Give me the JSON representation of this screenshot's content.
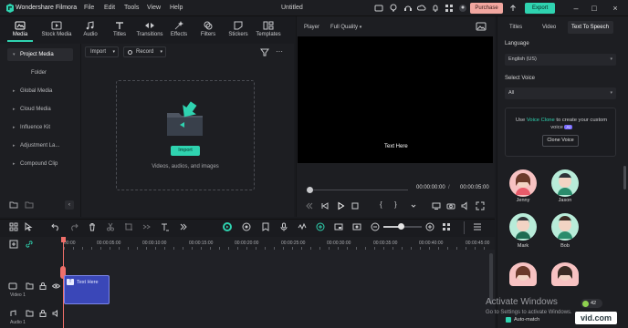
{
  "titlebar": {
    "app_name": "Wondershare Filmora",
    "menu": [
      "File",
      "Edit",
      "Tools",
      "View",
      "Help"
    ],
    "project_title": "Untitled",
    "purchase_label": "Purchase",
    "export_label": "Export"
  },
  "toolbar": {
    "tabs": [
      "Media",
      "Stock Media",
      "Audio",
      "Titles",
      "Transitions",
      "Effects",
      "Filters",
      "Stickers",
      "Templates"
    ],
    "active_tab": "Media"
  },
  "sidebar": {
    "items": [
      "Project Media",
      "Folder",
      "Global Media",
      "Cloud Media",
      "Influence Kit",
      "Adjustment La...",
      "Compound Clip"
    ],
    "selected": "Project Media"
  },
  "media": {
    "import_label": "Import",
    "record_label": "Record",
    "import_button": "Import",
    "drop_caption": "Videos, audios, and images"
  },
  "player": {
    "label": "Player",
    "quality": "Full Quality",
    "overlay_text": "Text Here",
    "current_time": "00:00:00:00",
    "total_time": "00:00:05:00"
  },
  "right_panel": {
    "tabs": [
      "Titles",
      "Video",
      "Text To Speech"
    ],
    "active_tab": "Text To Speech",
    "language_label": "Language",
    "language_value": "English (US)",
    "voice_label": "Select Voice",
    "voice_value": "All",
    "clone_text_before": "Use",
    "clone_link": "Voice Clone",
    "clone_text_after": "to create your custom voice",
    "ai_badge": "AI",
    "clone_button": "Clone Voice",
    "voices": [
      "Jenny",
      "Jason",
      "Mark",
      "Bob"
    ]
  },
  "timeline": {
    "ruler": [
      "00:00",
      "00:00:05:00",
      "00:00:10:00",
      "00:00:15:00",
      "00:00:20:00",
      "00:00:25:00",
      "00:00:30:00",
      "00:00:35:00",
      "00:00:40:00",
      "00:00:45:00"
    ],
    "clip_label": "Text Here",
    "video_track": "Video 1",
    "audio_track": "Audio 1"
  },
  "overlay": {
    "watermark_title": "Activate Windows",
    "watermark_sub": "Go to Settings to activate Windows.",
    "counter": "42",
    "automatch": "Auto-match",
    "vid_logo": "vid.com"
  },
  "colors": {
    "accent": "#2fd3b0",
    "purchase": "#f2a7a0",
    "playhead": "#ef6f6a",
    "clip": "#3a47b8"
  }
}
